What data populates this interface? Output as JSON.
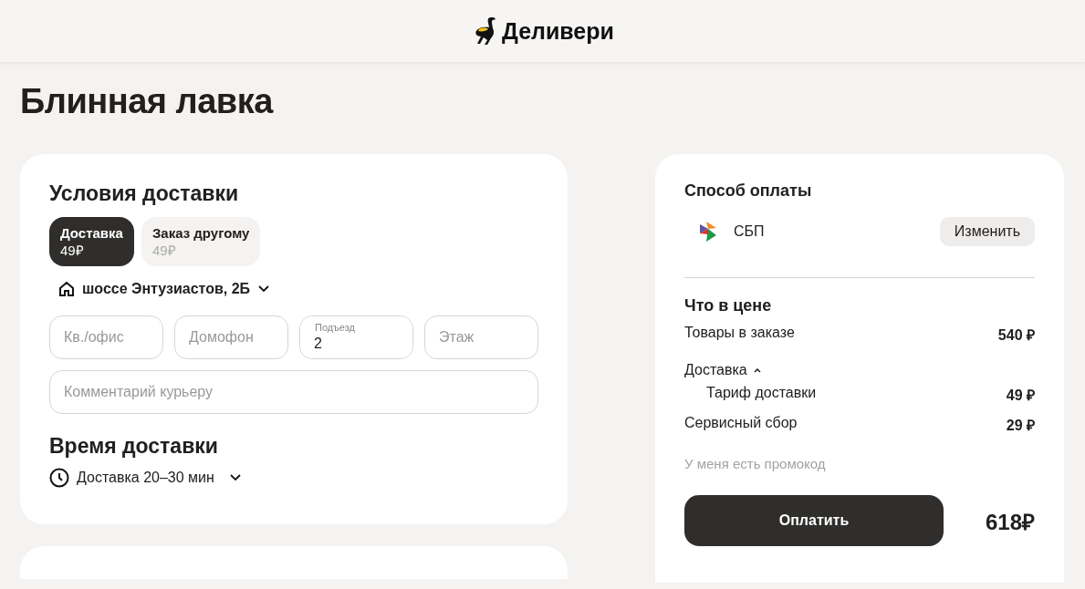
{
  "header": {
    "logo_text": "Деливери"
  },
  "page_title": "Блинная лавка",
  "delivery": {
    "title": "Условия доставки",
    "tabs": [
      {
        "label": "Доставка",
        "price": "49₽",
        "selected": true
      },
      {
        "label": "Заказ другому",
        "price": "49₽",
        "selected": false
      }
    ],
    "address": "шоссе Энтузиастов, 2Б",
    "fields": [
      {
        "placeholder": "Кв./офис"
      },
      {
        "placeholder": "Домофон"
      },
      {
        "label": "Подъезд",
        "value": "2"
      },
      {
        "placeholder": "Этаж"
      }
    ],
    "comment": {
      "placeholder": "Комментарий курьеру"
    },
    "time_title": "Время доставки",
    "time_option": "Доставка 20–30 мин"
  },
  "payment": {
    "title": "Способ оплаты",
    "method": "СБП",
    "change_button": "Изменить",
    "price_title": "Что в цене",
    "price_rows": [
      {
        "label": "Товары в заказе",
        "value": "540 ₽"
      },
      {
        "label": "Доставка",
        "expanded": true,
        "children": [
          {
            "label": "Тариф доставки",
            "value": "49 ₽"
          }
        ]
      },
      {
        "label": "Сервисный сбор",
        "value": "29 ₽"
      }
    ],
    "promo_link": "У меня есть промокод",
    "pay_button": "Оплатить",
    "total": "618₽"
  }
}
